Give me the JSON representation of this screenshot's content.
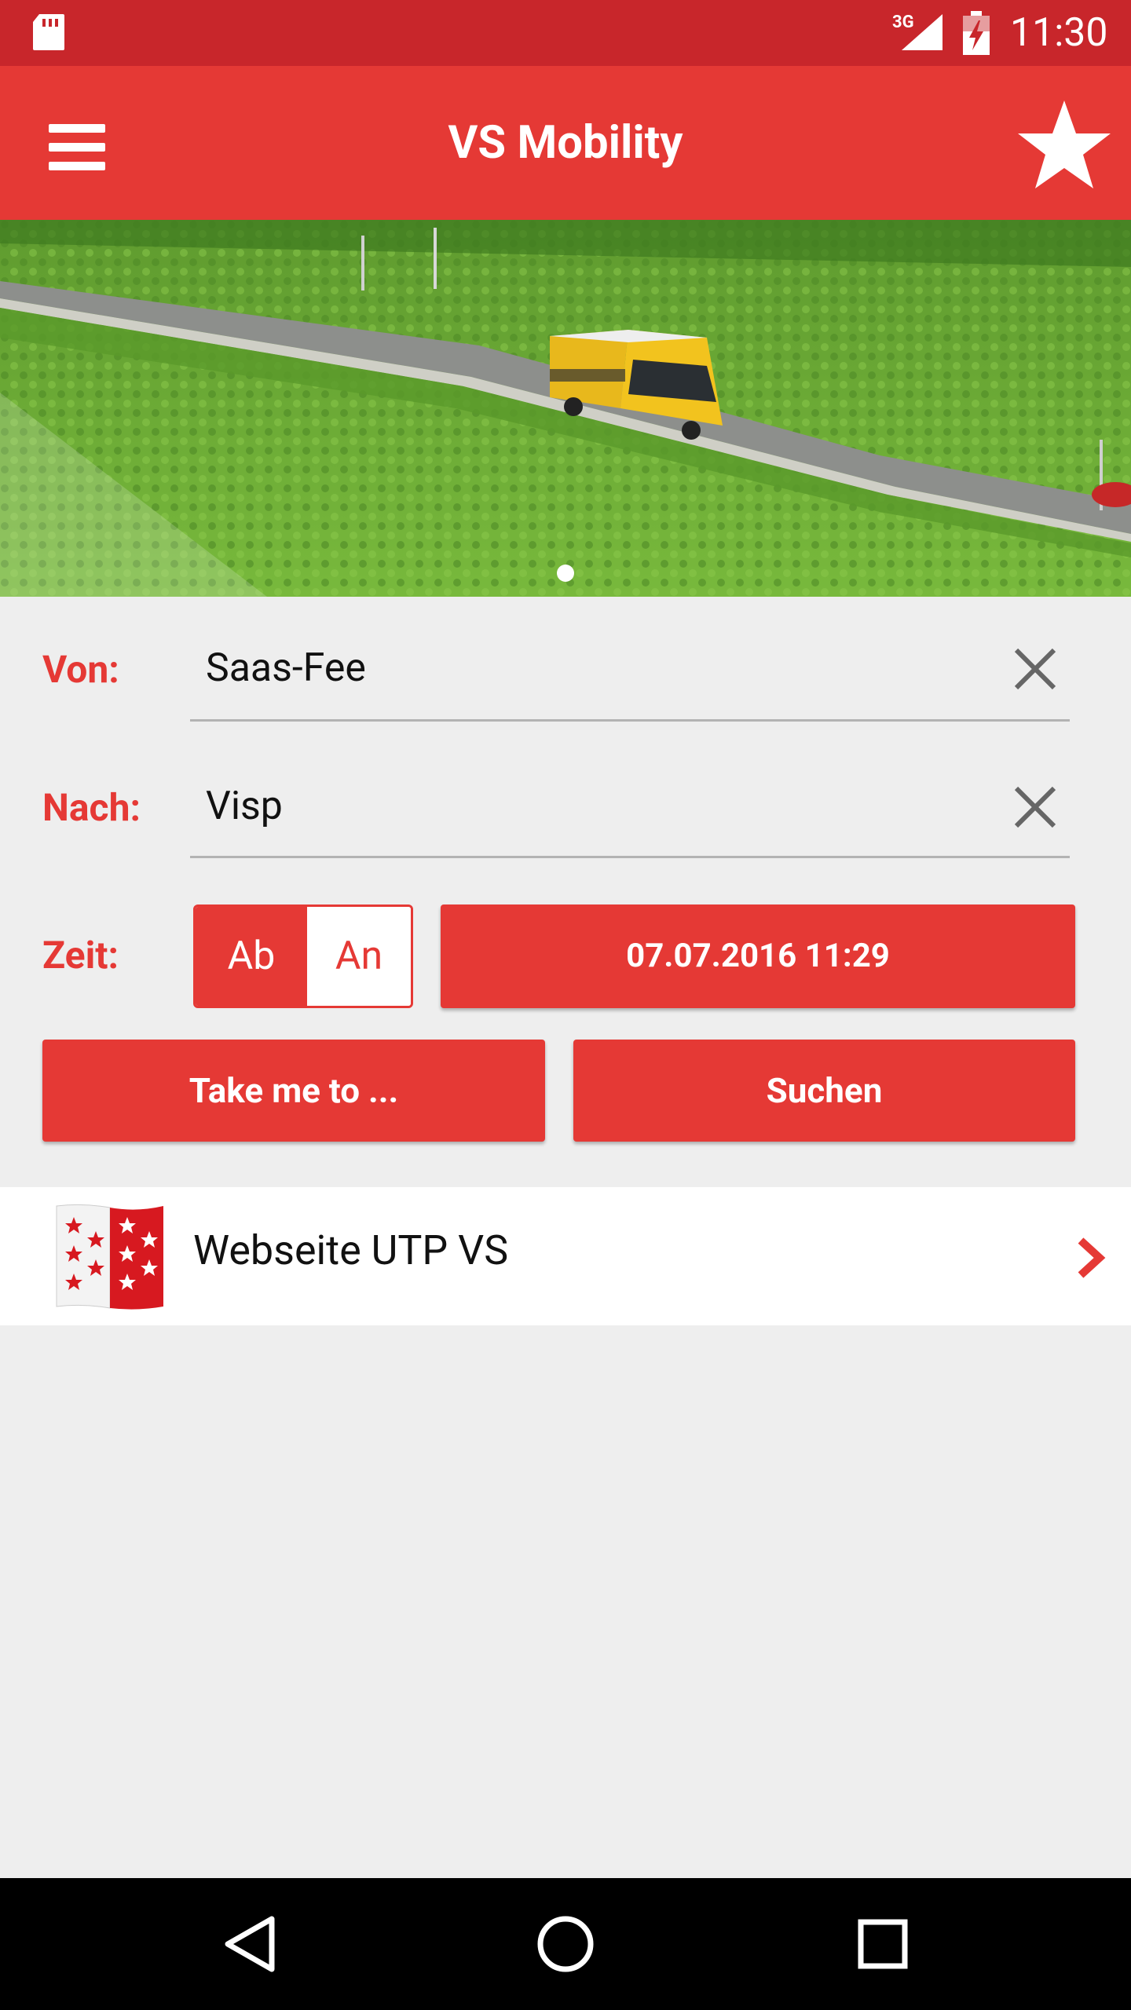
{
  "status_bar": {
    "network": "3G",
    "time": "11:30",
    "icons": [
      "sd-card-icon",
      "signal-icon",
      "battery-charging-icon"
    ]
  },
  "app_bar": {
    "title": "VS Mobility",
    "menu_icon": "hamburger-menu-icon",
    "favorite_icon": "star-icon"
  },
  "hero": {
    "pages": 1,
    "active_page": 1
  },
  "form": {
    "from": {
      "label": "Von:",
      "value": "Saas-Fee"
    },
    "to": {
      "label": "Nach:",
      "value": "Visp"
    },
    "time": {
      "label": "Zeit:",
      "options": [
        "Ab",
        "An"
      ],
      "selected": "Ab",
      "datetime": "07.07.2016 11:29"
    },
    "buttons": {
      "take_me_to": "Take me to ...",
      "search": "Suchen"
    }
  },
  "link": {
    "label": "Webseite UTP VS",
    "icon": "valais-flag-icon"
  },
  "navigation": [
    "back-icon",
    "home-icon",
    "recents-icon"
  ],
  "colors": {
    "status_bar": "#c8262b",
    "primary": "#e53935",
    "background": "#eeeeee",
    "nav_bar": "#000000"
  }
}
